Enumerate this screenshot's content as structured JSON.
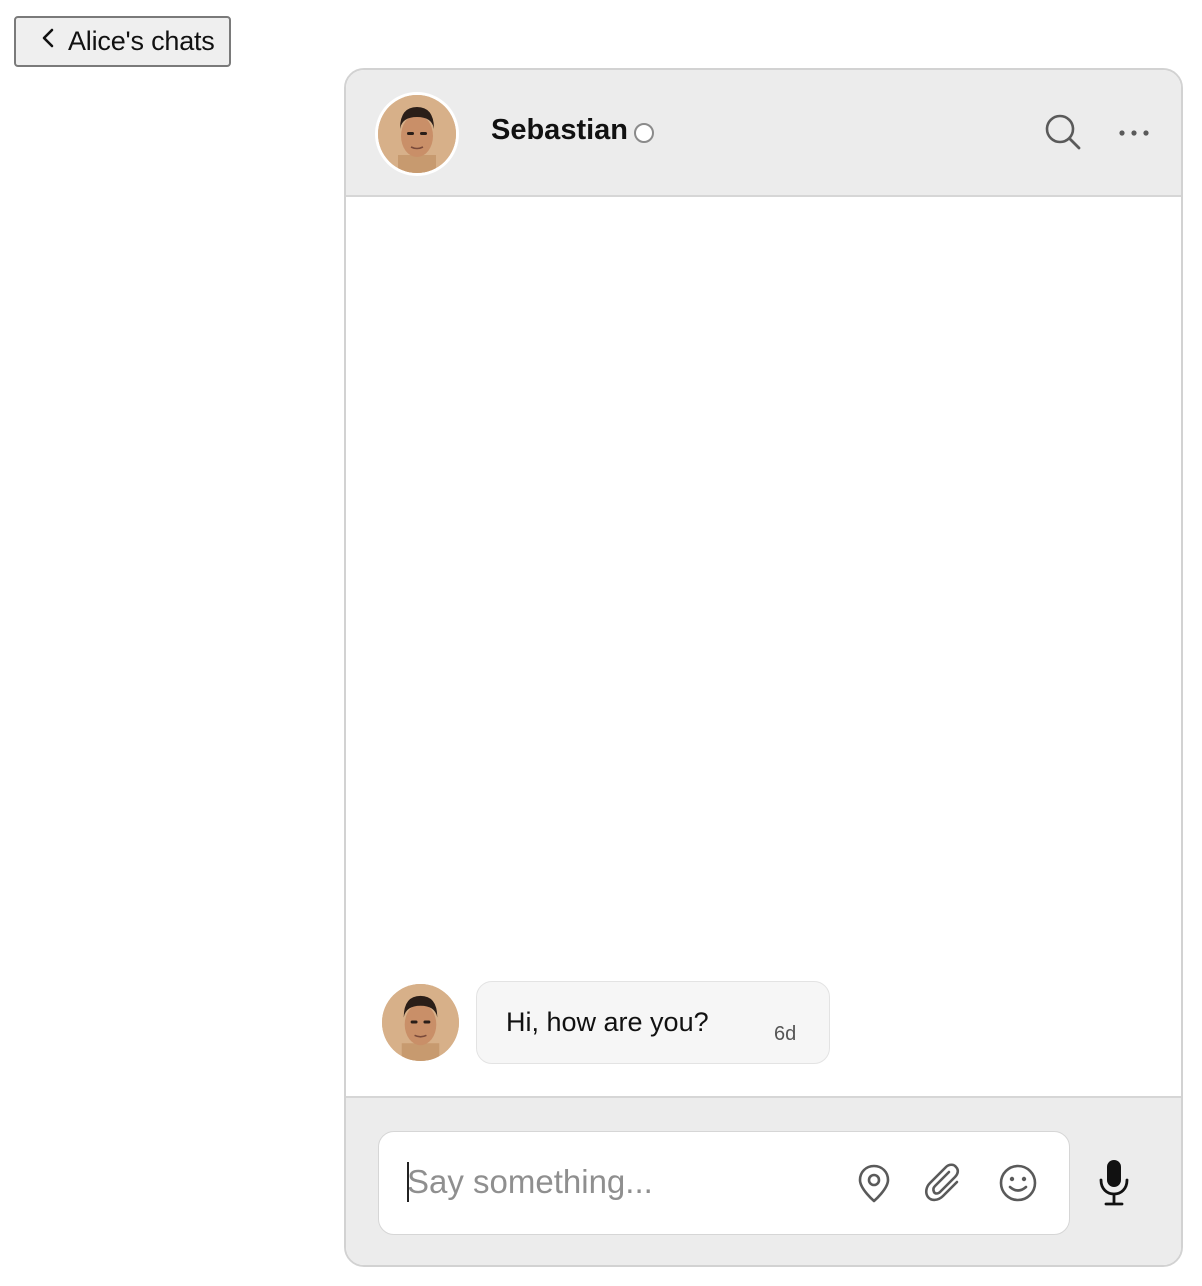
{
  "back_button": {
    "label": "Alice's chats"
  },
  "header": {
    "contact_name": "Sebastian",
    "presence": "offline"
  },
  "messages": [
    {
      "text": "Hi, how are you?",
      "time": "6d"
    }
  ],
  "composer": {
    "placeholder": "Say something..."
  },
  "colors": {
    "header_bg": "#ececec",
    "bubble_bg": "#f6f6f6",
    "icon": "#5a5a5a"
  }
}
